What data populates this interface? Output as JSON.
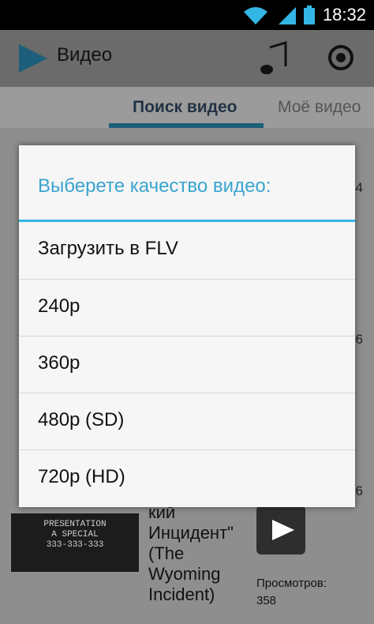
{
  "status": {
    "time": "18:32"
  },
  "app": {
    "title": "Видео"
  },
  "tabs": [
    {
      "label": "Поиск видео"
    },
    {
      "label": "Моё видео"
    }
  ],
  "background_item": {
    "title_fragment": "кий\nИнцидент\"\n(The\nWyoming\nIncident)",
    "views": "Просмотров:\n358",
    "thumb_text": "PRESENTATION\nA SPECIAL\n333-333-333",
    "side_numbers": [
      "4",
      "6",
      "6"
    ]
  },
  "dialog": {
    "title": "Выберете качество видео:",
    "options": [
      {
        "label": "Загрузить в FLV"
      },
      {
        "label": "240p"
      },
      {
        "label": "360p"
      },
      {
        "label": "480p (SD)"
      },
      {
        "label": "720p (HD)"
      }
    ]
  },
  "colors": {
    "accent": "#33b5e5",
    "tab_indicator": "#1e5f79"
  }
}
